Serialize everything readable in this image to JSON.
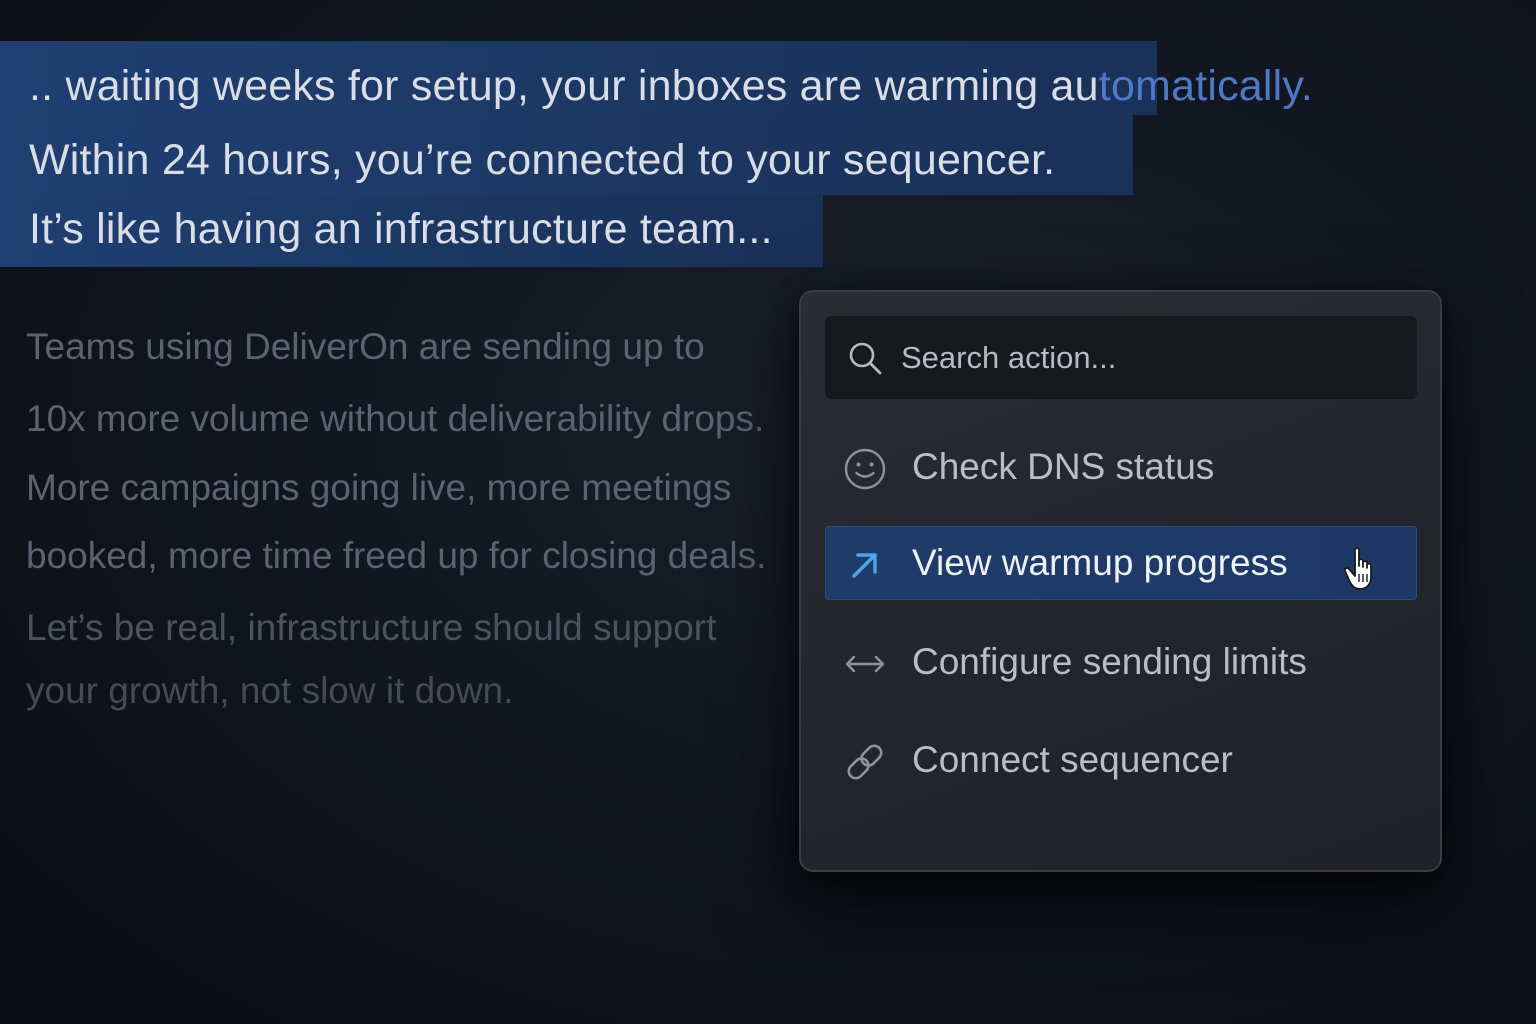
{
  "selection": {
    "line1_start": ".. waiting weeks for setup, your inboxes are warming au",
    "line1_accent": "tomatically.",
    "line2": "Within 24 hours, you’re connected to your sequencer.",
    "line3": "It’s like having an infrastructure team..."
  },
  "body": {
    "lines": [
      "Teams using DeliverOn are sending up to",
      "10x more volume without deliverability drops.",
      "More campaigns going live, more meetings",
      "booked, more time freed up for closing deals.",
      "Let’s be real, infrastructure should support",
      "your growth, not slow it down."
    ]
  },
  "palette": {
    "search": {
      "placeholder": "Search action...",
      "icon": "search-icon"
    },
    "items": [
      {
        "label": "Check DNS status",
        "icon": "smiley-face-icon",
        "highlighted": false
      },
      {
        "label": "View warmup progress",
        "icon": "arrow-up-right-icon",
        "highlighted": true
      },
      {
        "label": "Configure sending limits",
        "icon": "double-arrow-horizontal-icon",
        "highlighted": false
      },
      {
        "label": "Connect sequencer",
        "icon": "link-icon",
        "highlighted": false
      }
    ],
    "cursor": "hand-pointer-icon"
  },
  "colors": {
    "background": "#121620",
    "selection_highlight": "#1f3f72",
    "accent_text": "#4f79c6",
    "active_item": "#1f3c6a",
    "arrow_icon": "#4aa8e8"
  }
}
